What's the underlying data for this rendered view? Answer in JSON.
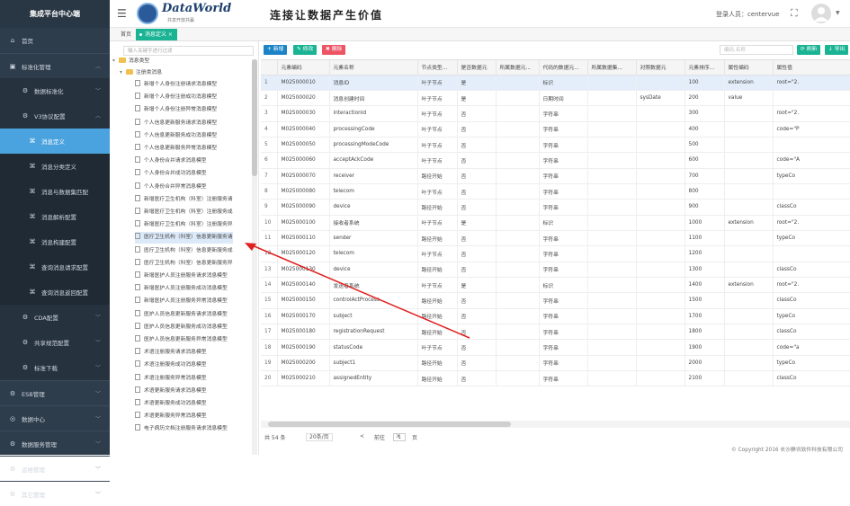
{
  "sidebar": {
    "title": "集成平台中心端",
    "items": [
      {
        "label": "首页",
        "icon": "home-icon",
        "level": 0
      },
      {
        "label": "标准化管理",
        "icon": "cube-icon",
        "level": 0,
        "expanded": true
      },
      {
        "label": "数据标准化",
        "icon": "gear-icon",
        "level": 1
      },
      {
        "label": "V3协议配置",
        "icon": "gear-icon",
        "level": 1,
        "expanded": true
      },
      {
        "label": "消息定义",
        "icon": "code-icon",
        "level": 2,
        "active": true
      },
      {
        "label": "消息分类定义",
        "icon": "code-icon",
        "level": 2
      },
      {
        "label": "消息与数据集匹配",
        "icon": "code-icon",
        "level": 2
      },
      {
        "label": "消息解析配置",
        "icon": "code-icon",
        "level": 2
      },
      {
        "label": "消息构建配置",
        "icon": "code-icon",
        "level": 2
      },
      {
        "label": "查询消息请求配置",
        "icon": "code-icon",
        "level": 2
      },
      {
        "label": "查询消息返回配置",
        "icon": "code-icon",
        "level": 2
      },
      {
        "label": "CDA配置",
        "icon": "gear-icon",
        "level": 1
      },
      {
        "label": "共享规范配置",
        "icon": "gear-icon",
        "level": 1
      },
      {
        "label": "标准下载",
        "icon": "gear-icon",
        "level": 1
      },
      {
        "label": "ESB管理",
        "icon": "gear-icon",
        "level": 0
      },
      {
        "label": "数据中心",
        "icon": "globe-icon",
        "level": 0
      },
      {
        "label": "数据服务管理",
        "icon": "gear-icon",
        "level": 0
      },
      {
        "label": "运维管理",
        "icon": "gear-icon",
        "level": 0
      },
      {
        "label": "其它管理",
        "icon": "gear-icon",
        "level": 0
      }
    ]
  },
  "header": {
    "logo_text": "DataWorld",
    "logo_sub": "共享开放共赢",
    "slogan": "连接让数据产生价值",
    "user_label": "登录人员：centervue"
  },
  "tabs": [
    {
      "label": "首页"
    },
    {
      "label": "消息定义 ×",
      "active": true
    }
  ],
  "tree": {
    "search_placeholder": "输入关键字进行过滤",
    "root": "消息类型",
    "group": "注册类消息",
    "items": [
      "新增个人身份注册请求消息模型",
      "新增个人身份注册成功消息模型",
      "新增个人身份注册异常消息模型",
      "个人信息更新服务请求消息模型",
      "个人信息更新服务成功消息模型",
      "个人信息更新服务异常消息模型",
      "个人身份合并请求消息模型",
      "个人身份合并成功消息模型",
      "个人身份合并异常消息模型",
      "新增医疗卫生机构（科室）注册服务请",
      "新增医疗卫生机构（科室）注册服务成",
      "新增医疗卫生机构（科室）注册服务异",
      "医疗卫生机构（科室）信息更新服务请",
      "医疗卫生机构（科室）信息更新服务成",
      "医疗卫生机构（科室）信息更新服务异",
      "新增医护人员注册服务请求消息模型",
      "新增医护人员注册服务成功消息模型",
      "新增医护人员注册服务异常消息模型",
      "医护人员信息更新服务请求消息模型",
      "医护人员信息更新服务成功消息模型",
      "医护人员信息更新服务异常消息模型",
      "术语注册服务请求消息模型",
      "术语注册服务成功消息模型",
      "术语注册服务异常消息模型",
      "术语更新服务请求消息模型",
      "术语更新服务成功消息模型",
      "术语更新服务异常消息模型",
      "电子病历文档注册服务请求消息模型"
    ],
    "selected_index": 12
  },
  "toolbar": {
    "add": "+ 新增",
    "edit": "✎ 修改",
    "delete": "✖ 删除",
    "search_placeholder": "编码,名称",
    "refresh": "⟳ 刷新",
    "export": "↓ 导出"
  },
  "table": {
    "columns": [
      "",
      "元素编码",
      "元素名称",
      "节点类型...",
      "是否数据元",
      "所属数据元...",
      "代码的数据元...",
      "所属数据集...",
      "对照数据元",
      "元素排序...",
      "属性编码",
      "属性值"
    ],
    "rows": [
      [
        "1",
        "M025000010",
        "消息ID",
        "叶子节点",
        "是",
        "",
        "标识",
        "",
        "",
        "100",
        "extension",
        "root=\"2."
      ],
      [
        "2",
        "M025000020",
        "消息创建时间",
        "叶子节点",
        "是",
        "",
        "日期时间",
        "",
        "sysDate",
        "200",
        "value",
        ""
      ],
      [
        "3",
        "M025000030",
        "interactionId",
        "叶子节点",
        "否",
        "",
        "字符串",
        "",
        "",
        "300",
        "",
        "root=\"2."
      ],
      [
        "4",
        "M025000040",
        "processingCode",
        "叶子节点",
        "否",
        "",
        "字符串",
        "",
        "",
        "400",
        "",
        "code=\"P"
      ],
      [
        "5",
        "M025000050",
        "processingModeCode",
        "叶子节点",
        "否",
        "",
        "字符串",
        "",
        "",
        "500",
        "",
        ""
      ],
      [
        "6",
        "M025000060",
        "acceptAckCode",
        "叶子节点",
        "否",
        "",
        "字符串",
        "",
        "",
        "600",
        "",
        "code=\"A"
      ],
      [
        "7",
        "M025000070",
        "receiver",
        "路径开始",
        "否",
        "",
        "字符串",
        "",
        "",
        "700",
        "",
        "typeCo"
      ],
      [
        "8",
        "M025000080",
        "telecom",
        "叶子节点",
        "否",
        "",
        "字符串",
        "",
        "",
        "800",
        "",
        ""
      ],
      [
        "9",
        "M025000090",
        "device",
        "路径开始",
        "否",
        "",
        "字符串",
        "",
        "",
        "900",
        "",
        "classCo"
      ],
      [
        "10",
        "M025000100",
        "接收者系统",
        "叶子节点",
        "是",
        "",
        "标识",
        "",
        "",
        "1000",
        "extension",
        "root=\"2."
      ],
      [
        "11",
        "M025000110",
        "sender",
        "路径开始",
        "否",
        "",
        "字符串",
        "",
        "",
        "1100",
        "",
        "typeCo"
      ],
      [
        "12",
        "M025000120",
        "telecom",
        "叶子节点",
        "否",
        "",
        "字符串",
        "",
        "",
        "1200",
        "",
        ""
      ],
      [
        "13",
        "M025000130",
        "device",
        "路径开始",
        "否",
        "",
        "字符串",
        "",
        "",
        "1300",
        "",
        "classCo"
      ],
      [
        "14",
        "M025000140",
        "发送者系统",
        "叶子节点",
        "是",
        "",
        "标识",
        "",
        "",
        "1400",
        "extension",
        "root=\"2."
      ],
      [
        "15",
        "M025000150",
        "controlActProcess",
        "路径开始",
        "否",
        "",
        "字符串",
        "",
        "",
        "1500",
        "",
        "classCo"
      ],
      [
        "16",
        "M025000170",
        "subject",
        "路径开始",
        "否",
        "",
        "字符串",
        "",
        "",
        "1700",
        "",
        "typeCo"
      ],
      [
        "17",
        "M025000180",
        "registrationRequest",
        "路径开始",
        "否",
        "",
        "字符串",
        "",
        "",
        "1800",
        "",
        "classCo"
      ],
      [
        "18",
        "M025000190",
        "statusCode",
        "叶子节点",
        "否",
        "",
        "字符串",
        "",
        "",
        "1900",
        "",
        "code=\"a"
      ],
      [
        "19",
        "M025000200",
        "subject1",
        "路径开始",
        "否",
        "",
        "字符串",
        "",
        "",
        "2000",
        "",
        "typeCo"
      ],
      [
        "20",
        "M025000210",
        "assignedEntity",
        "路径开始",
        "否",
        "",
        "字符串",
        "",
        "",
        "2100",
        "",
        "classCo"
      ]
    ]
  },
  "pager": {
    "total": "共 54 条",
    "size": "20条/页",
    "prev": "<",
    "next": ">",
    "goto": "前往",
    "page": "1",
    "page_unit": "页"
  },
  "footer": "© Copyright 2016 长沙静讯软件科技有限公司",
  "colors": {
    "sidebar_bg": "#2e3d4c",
    "active": "#4aa3df",
    "primary": "#1c84c6",
    "success": "#1ab394",
    "danger": "#ed5565",
    "annotation_arrow": "#e02020"
  }
}
